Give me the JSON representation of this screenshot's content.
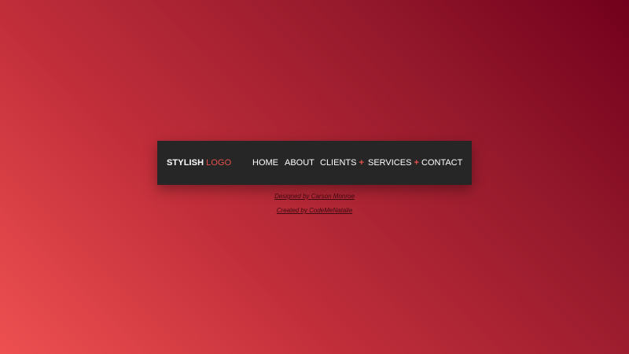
{
  "nav": {
    "logo": {
      "primary": "STYLISH",
      "accent": "LOGO"
    },
    "items": [
      {
        "label": "HOME",
        "submenu_indicator": ""
      },
      {
        "label": "ABOUT",
        "submenu_indicator": ""
      },
      {
        "label": "CLIENTS",
        "submenu_indicator": "+"
      },
      {
        "label": "SERVICES",
        "submenu_indicator": "+"
      },
      {
        "label": "CONTACT",
        "submenu_indicator": ""
      }
    ]
  },
  "credits": {
    "designed_by": "Designed by Carson Monroe",
    "created_by": "Created by CodeMeNatalie"
  },
  "colors": {
    "nav_background": "#262626",
    "accent": "#e8504d",
    "gradient_light": "#ee5050",
    "gradient_dark": "#72001c"
  }
}
